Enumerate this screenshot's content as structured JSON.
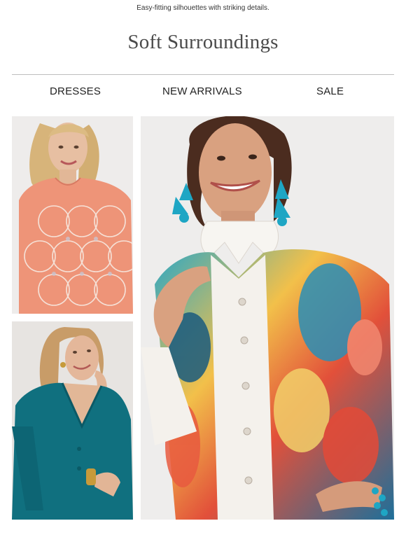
{
  "preheader": "Easy-fitting silhouettes with striking details.",
  "brand": {
    "name": "Soft Surroundings"
  },
  "nav": {
    "items": [
      "DRESSES",
      "NEW ARRIVALS",
      "SALE"
    ]
  },
  "products": [
    {
      "photo": "coral-embellished-tunic-photo",
      "accent": "#ec8e74"
    },
    {
      "photo": "teal-tunic-photo",
      "accent": "#0f6f80"
    },
    {
      "photo": "watercolor-print-shirt-photo",
      "accent": "#1ca8c9"
    }
  ]
}
